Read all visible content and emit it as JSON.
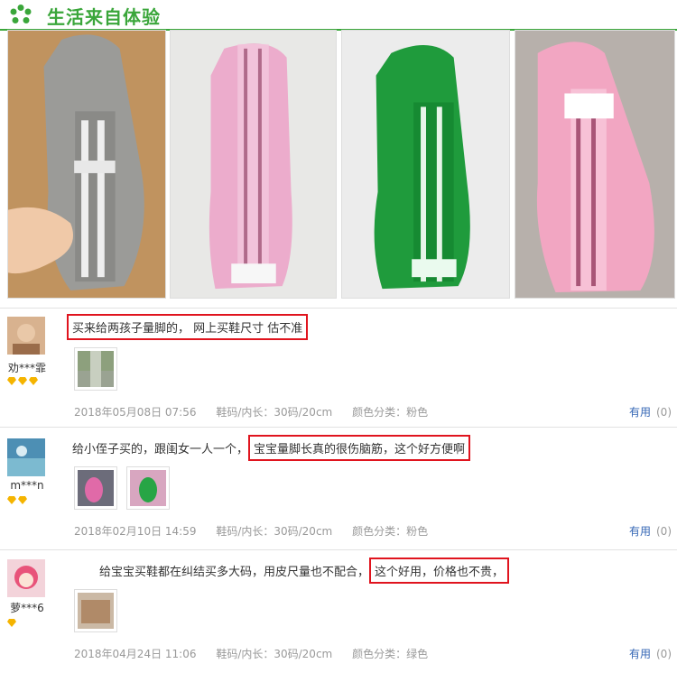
{
  "header": {
    "title": "生活来自体验",
    "icon": "flower-icon",
    "accent": "#3aa63a"
  },
  "photos": [
    {
      "name": "gray-foot-measure-photo",
      "color": "#9b9b98"
    },
    {
      "name": "pink-foot-measure-photo",
      "color": "#ecaccc"
    },
    {
      "name": "green-foot-measure-photo",
      "color": "#1f9b3c"
    },
    {
      "name": "pink-foot-measure-photo-2",
      "color": "#f2a6c2"
    }
  ],
  "reviews": [
    {
      "user": "劝***霏",
      "level": 3,
      "text_parts": [
        {
          "text": "买来给两孩子量脚的，      网上买鞋尺寸    估不准",
          "highlight": true
        }
      ],
      "date": "2018年05月08日 07:56",
      "size": "鞋码/内长：30码/20cm",
      "color": "颜色分类：粉色",
      "useful_label": "有用",
      "useful_count": "(0)"
    },
    {
      "user": "m***n",
      "level": 2,
      "text_parts": [
        {
          "text": "给小侄子买的，跟闺女一人一个，",
          "highlight": false
        },
        {
          "text": "宝宝量脚长真的很伤脑筋，这个好方便啊",
          "highlight": true
        }
      ],
      "date": "2018年02月10日 14:59",
      "size": "鞋码/内长：30码/20cm",
      "color": "颜色分类：粉色",
      "useful_label": "有用",
      "useful_count": "(0)"
    },
    {
      "user": "萝***6",
      "level": 1,
      "text_parts": [
        {
          "text": "给宝宝买鞋都在纠结买多大码，用皮尺量也不配合，",
          "highlight": false
        },
        {
          "text": "这个好用，价格也不贵，",
          "highlight": true
        }
      ],
      "date": "2018年04月24日 11:06",
      "size": "鞋码/内长：30码/20cm",
      "color": "颜色分类：绿色",
      "useful_label": "有用",
      "useful_count": "(0)"
    }
  ]
}
